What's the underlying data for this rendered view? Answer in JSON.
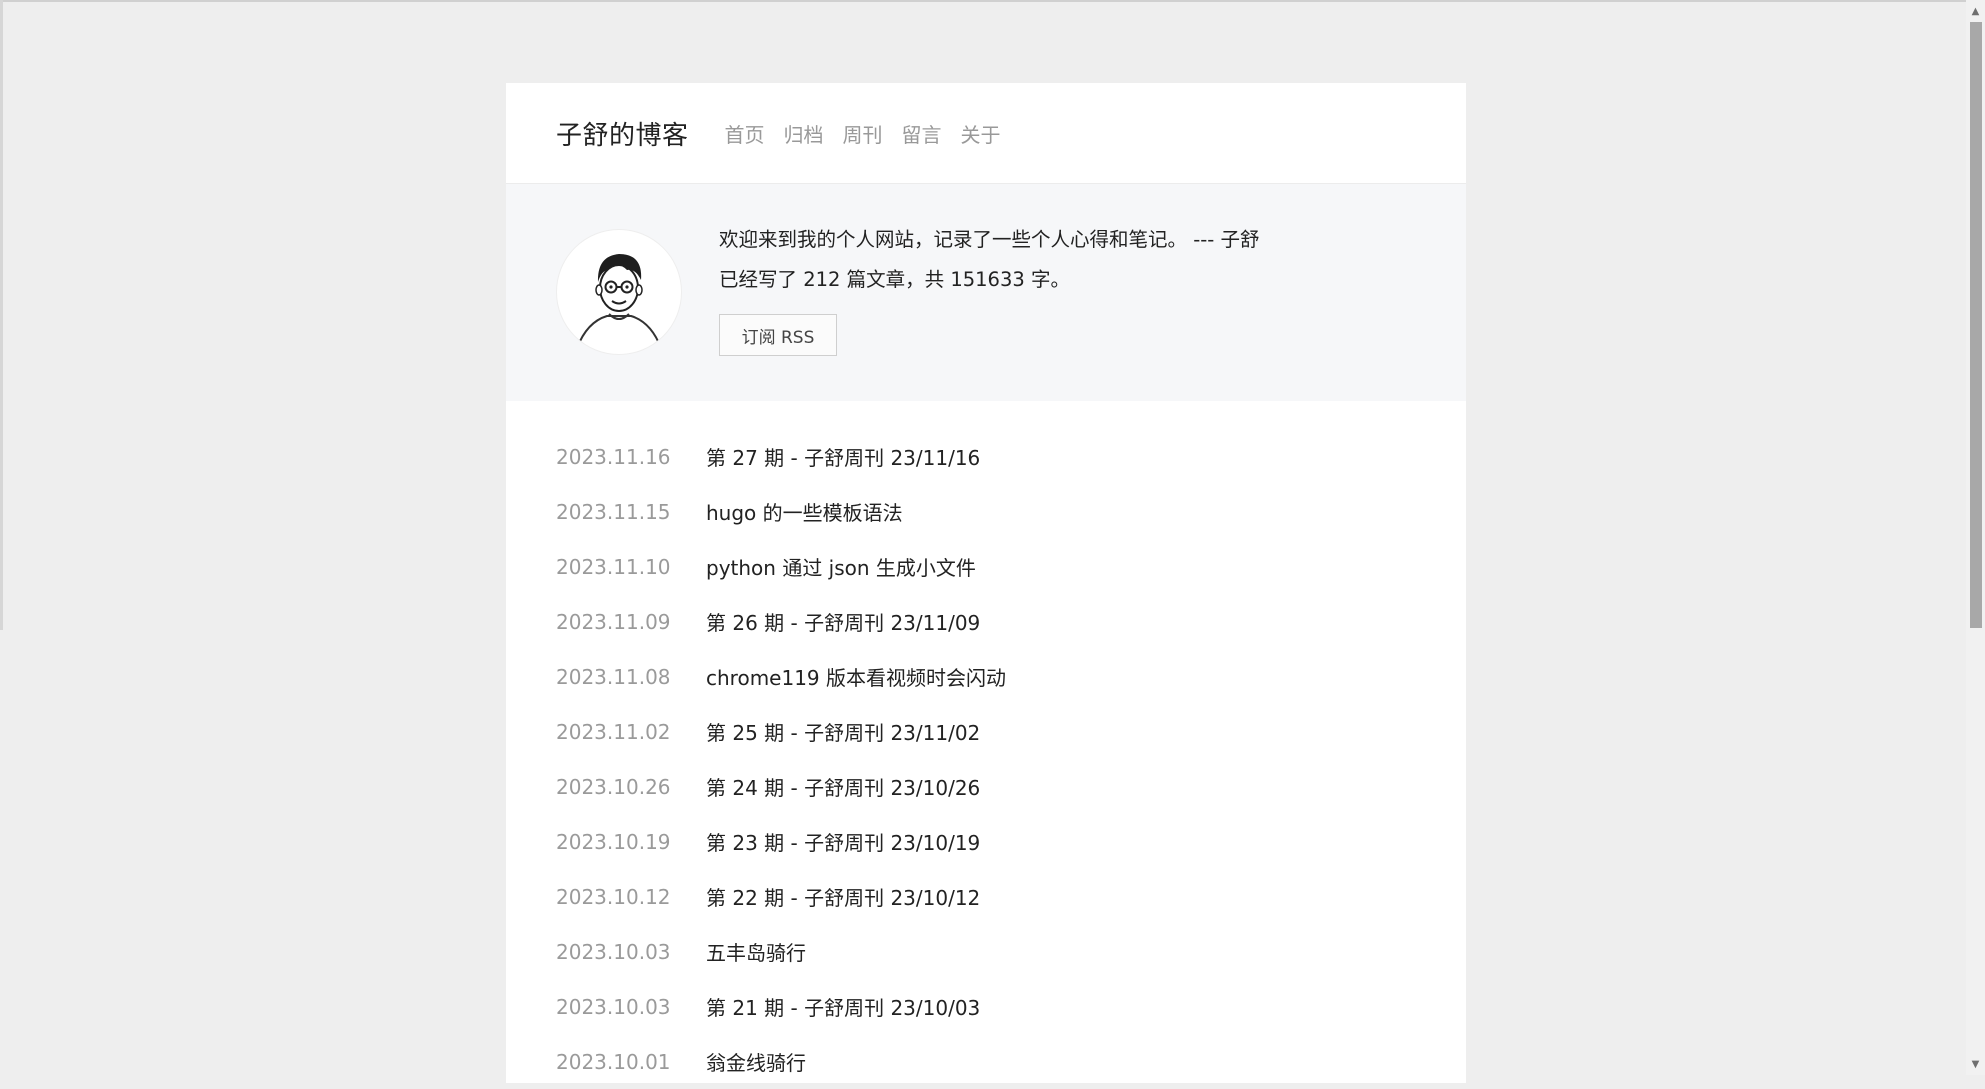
{
  "header": {
    "site_title": "子舒的博客",
    "nav": [
      "首页",
      "归档",
      "周刊",
      "留言",
      "关于"
    ]
  },
  "intro": {
    "welcome": "欢迎来到我的个人网站，记录了一些个人心得和笔记。 --- 子舒",
    "stats": "已经写了 212 篇文章，共 151633 字。",
    "rss_label": "订阅 RSS",
    "avatar_icon": "avatar-portrait-icon"
  },
  "posts": [
    {
      "date": "2023.11.16",
      "title": "第 27 期 - 子舒周刊 23/11/16"
    },
    {
      "date": "2023.11.15",
      "title": "hugo 的一些模板语法"
    },
    {
      "date": "2023.11.10",
      "title": "python 通过 json 生成小文件"
    },
    {
      "date": "2023.11.09",
      "title": "第 26 期 - 子舒周刊 23/11/09"
    },
    {
      "date": "2023.11.08",
      "title": "chrome119 版本看视频时会闪动"
    },
    {
      "date": "2023.11.02",
      "title": "第 25 期 - 子舒周刊 23/11/02"
    },
    {
      "date": "2023.10.26",
      "title": "第 24 期 - 子舒周刊 23/10/26"
    },
    {
      "date": "2023.10.19",
      "title": "第 23 期 - 子舒周刊 23/10/19"
    },
    {
      "date": "2023.10.12",
      "title": "第 22 期 - 子舒周刊 23/10/12"
    },
    {
      "date": "2023.10.03",
      "title": "五丰岛骑行"
    },
    {
      "date": "2023.10.03",
      "title": "第 21 期 - 子舒周刊 23/10/03"
    },
    {
      "date": "2023.10.01",
      "title": "翁金线骑行"
    }
  ],
  "colors": {
    "page_bg": "#eeeeee",
    "card_bg": "#ffffff",
    "intro_bg": "#f6f7f9",
    "nav_text": "#999999",
    "date_text": "#9a9a9a",
    "body_text": "#222222"
  }
}
